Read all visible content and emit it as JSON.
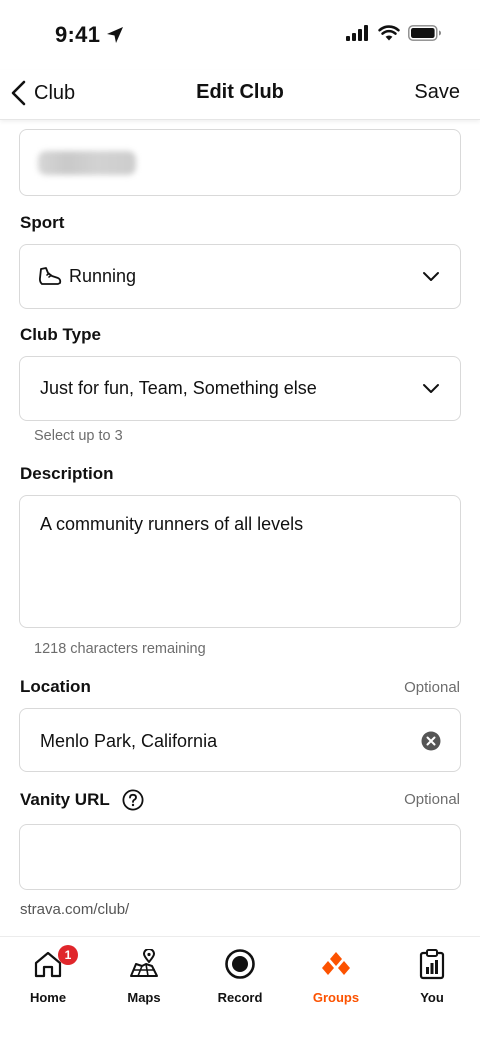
{
  "status_bar": {
    "time": "9:41"
  },
  "nav": {
    "back_label": "Club",
    "title": "Edit Club",
    "save_label": "Save"
  },
  "form": {
    "sport": {
      "label": "Sport",
      "value": "Running"
    },
    "club_type": {
      "label": "Club Type",
      "value": "Just for fun, Team, Something else",
      "hint": "Select up to 3"
    },
    "description": {
      "label": "Description",
      "value": "A community runners of all levels",
      "hint": "1218 characters remaining"
    },
    "location": {
      "label": "Location",
      "optional": "Optional",
      "value": "Menlo Park, California"
    },
    "vanity_url": {
      "label": "Vanity URL",
      "optional": "Optional",
      "value": "",
      "prefix": "strava.com/club/"
    }
  },
  "tabs": [
    {
      "label": "Home",
      "badge": "1"
    },
    {
      "label": "Maps"
    },
    {
      "label": "Record"
    },
    {
      "label": "Groups"
    },
    {
      "label": "You"
    }
  ],
  "colors": {
    "accent": "#fc5200",
    "badge": "#e0262b"
  }
}
